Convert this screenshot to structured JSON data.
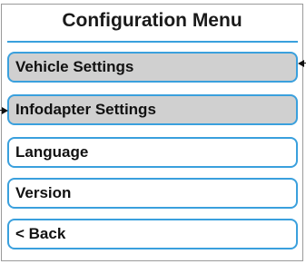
{
  "screen": {
    "title": "Configuration Menu"
  },
  "menu": {
    "items": [
      {
        "label": "Vehicle Settings",
        "highlighted": true
      },
      {
        "label": "Infodapter Settings",
        "highlighted": true
      },
      {
        "label": "Language",
        "highlighted": false
      },
      {
        "label": "Version",
        "highlighted": false
      },
      {
        "label": "< Back",
        "highlighted": false
      }
    ]
  },
  "colors": {
    "accent": "#3aa0dd",
    "highlight": "#d0d0d0",
    "text": "#111111"
  }
}
